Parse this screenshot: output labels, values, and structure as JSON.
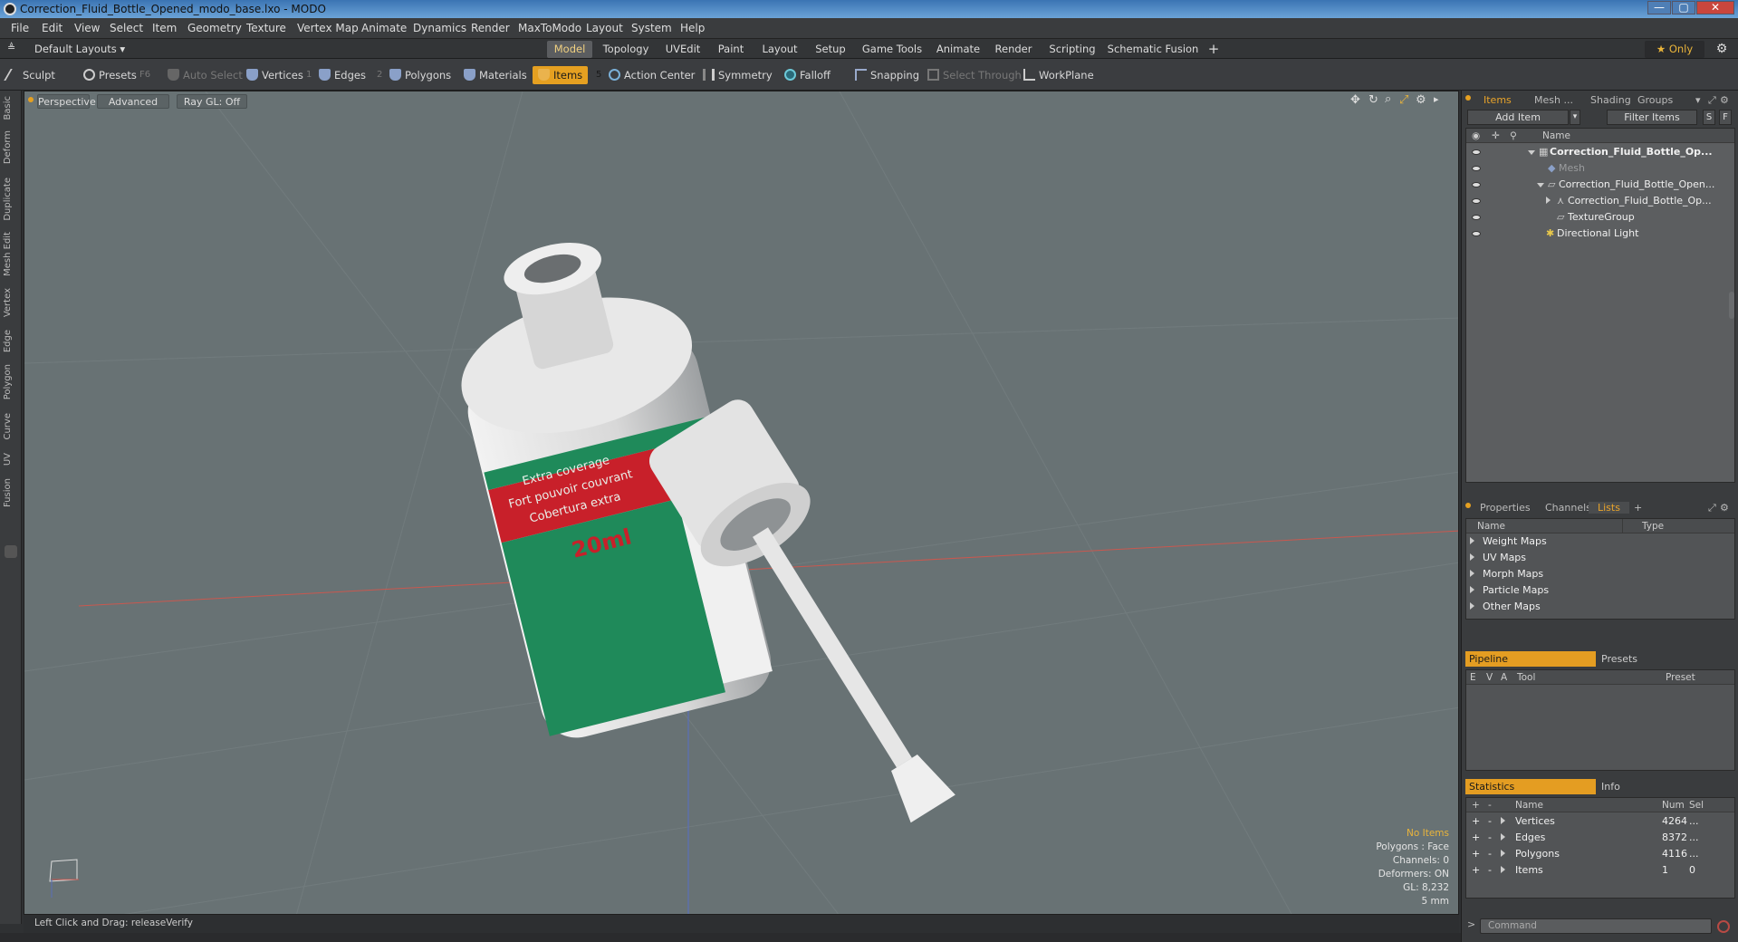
{
  "window": {
    "title": "Correction_Fluid_Bottle_Opened_modo_base.lxo - MODO",
    "minimize": "—",
    "maximize": "▢",
    "close": "✕"
  },
  "menu": [
    "File",
    "Edit",
    "View",
    "Select",
    "Item",
    "Geometry",
    "Texture",
    "Vertex Map",
    "Animate",
    "Dynamics",
    "Render",
    "MaxToModo",
    "Layout",
    "System",
    "Help"
  ],
  "layoutbar": {
    "layouts": "Default Layouts",
    "tabs": [
      "Model",
      "Topology",
      "UVEdit",
      "Paint",
      "Layout",
      "Setup",
      "Game Tools",
      "Animate",
      "Render",
      "Scripting",
      "Schematic Fusion"
    ],
    "active_tab": "Model",
    "plus": "+",
    "only": "Only"
  },
  "toolbar": {
    "sculpt": "Sculpt",
    "presets": "Presets",
    "presets_key": "F6",
    "auto_select": "Auto Select",
    "vertices": "Vertices",
    "vertices_key": "1",
    "edges": "Edges",
    "edges_key": "2",
    "polygons": "Polygons",
    "materials": "Materials",
    "items": "Items",
    "items_key": "5",
    "action_center": "Action Center",
    "symmetry": "Symmetry",
    "falloff": "Falloff",
    "snapping": "Snapping",
    "select_through": "Select Through",
    "workplane": "WorkPlane"
  },
  "leftstrip": [
    "Basic",
    "Deform",
    "Duplicate",
    "Mesh Edit",
    "Vertex",
    "Edge",
    "Polygon",
    "Curve",
    "UV",
    "Fusion"
  ],
  "viewport": {
    "perspective": "Perspective",
    "advanced": "Advanced",
    "raygl": "Ray GL: Off",
    "label_lines": [
      "Extra coverage",
      "Fort pouvoir couvrant",
      "Cobertura extra"
    ],
    "label_size": "20ml",
    "hud": {
      "no_items": "No Items",
      "polygons": "Polygons : Face",
      "channels": "Channels: 0",
      "deformers": "Deformers: ON",
      "gl": "GL: 8,232",
      "scale": "5 mm"
    }
  },
  "statusbar": "Left Click and Drag:  releaseVerify",
  "items_panel": {
    "tabs": [
      "Items",
      "Mesh ...",
      "Shading",
      "Groups"
    ],
    "add_item": "Add Item",
    "filter_items": "Filter Items",
    "s_btn": "S",
    "f_btn": "F",
    "col_name": "Name",
    "tree": [
      {
        "label": "Correction_Fluid_Bottle_Op...",
        "bold": true,
        "indent": 0
      },
      {
        "label": "Mesh",
        "dim": true,
        "indent": 1
      },
      {
        "label": "Correction_Fluid_Bottle_Open...",
        "indent": 1
      },
      {
        "label": "Correction_Fluid_Bottle_Op...",
        "indent": 2
      },
      {
        "label": "TextureGroup",
        "indent": 2
      },
      {
        "label": "Directional Light",
        "indent": 1
      }
    ]
  },
  "lists_panel": {
    "tabs": [
      "Properties",
      "Channels",
      "Lists"
    ],
    "col_name": "Name",
    "col_type": "Type",
    "rows": [
      "Weight Maps",
      "UV Maps",
      "Morph Maps",
      "Particle Maps",
      "Other Maps"
    ]
  },
  "pipeline_panel": {
    "tab_on": "Pipeline",
    "tab_off": "Presets",
    "cols": [
      "E",
      "V",
      "A",
      "Tool",
      "Preset"
    ]
  },
  "stats_panel": {
    "tab_on": "Statistics",
    "tab_off": "Info",
    "cols": [
      "+",
      "-",
      "Name",
      "Num",
      "Sel"
    ],
    "rows": [
      {
        "name": "Vertices",
        "num": "4264",
        "sel": "..."
      },
      {
        "name": "Edges",
        "num": "8372",
        "sel": "..."
      },
      {
        "name": "Polygons",
        "num": "4116",
        "sel": "..."
      },
      {
        "name": "Items",
        "num": "1",
        "sel": "0"
      }
    ]
  },
  "command": {
    "placeholder": "Command",
    "prompt": ">"
  },
  "colors": {
    "accent": "#e5a021",
    "viewport": "#687274",
    "bottle_green": "#1f8a5a",
    "bottle_red": "#c8202a"
  }
}
